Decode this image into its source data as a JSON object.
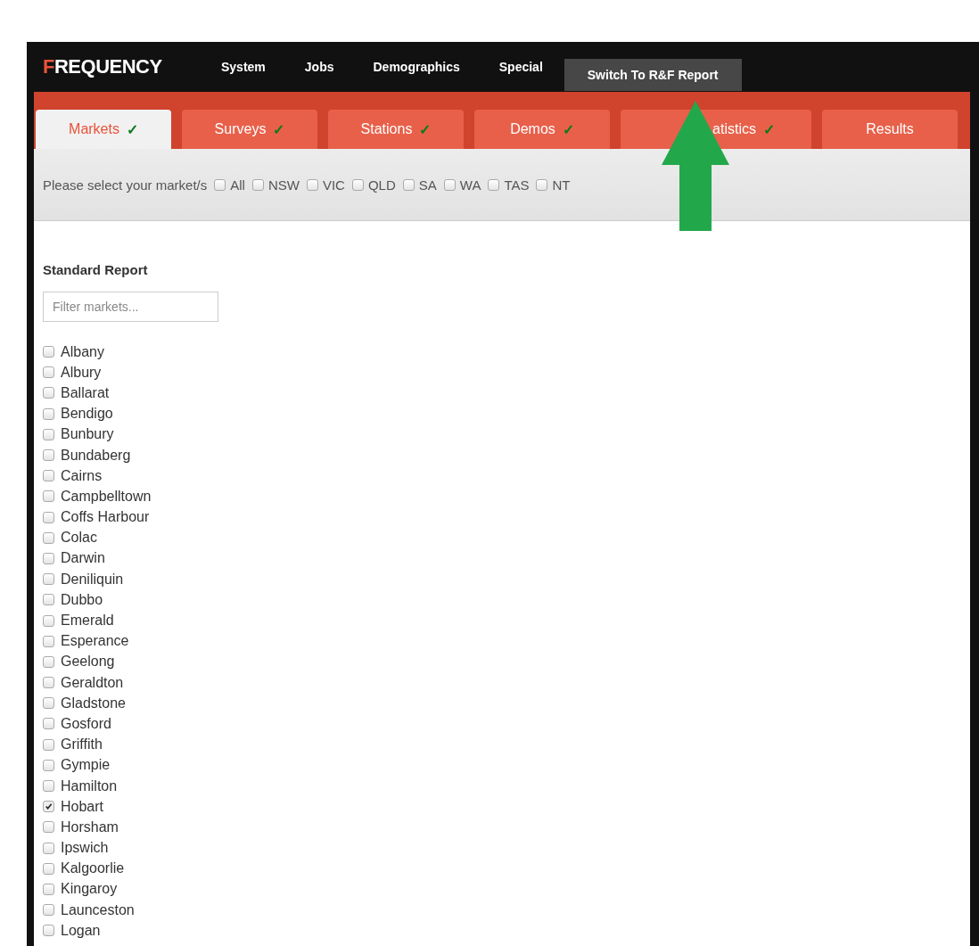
{
  "logo": {
    "initial": "F",
    "rest": "REQUENCY"
  },
  "nav": [
    {
      "label": "System",
      "selected": false
    },
    {
      "label": "Jobs",
      "selected": false
    },
    {
      "label": "Demographics",
      "selected": false
    },
    {
      "label": "Special",
      "selected": false
    },
    {
      "label": "Switch To R&F Report",
      "selected": true
    }
  ],
  "tabs": [
    {
      "label": "Markets",
      "check": "✓",
      "selected": true
    },
    {
      "label": "Surveys",
      "check": "✓",
      "selected": false
    },
    {
      "label": "Stations",
      "check": "✓",
      "selected": false
    },
    {
      "label": "Demos",
      "check": "✓",
      "selected": false
    },
    {
      "label": "atistics",
      "check": "✓",
      "selected": false,
      "covered": true
    },
    {
      "label": "Results",
      "selected": false
    }
  ],
  "region_bar": {
    "prompt": "Please select your market/s",
    "regions": [
      {
        "label": "All",
        "checked": false
      },
      {
        "label": "NSW",
        "checked": false
      },
      {
        "label": "VIC",
        "checked": false
      },
      {
        "label": "QLD",
        "checked": false
      },
      {
        "label": "SA",
        "checked": false
      },
      {
        "label": "WA",
        "checked": false
      },
      {
        "label": "TAS",
        "checked": false
      },
      {
        "label": "NT",
        "checked": false
      }
    ]
  },
  "section_title": "Standard Report",
  "filter": {
    "placeholder": "Filter markets..."
  },
  "markets": [
    {
      "label": "Albany",
      "checked": false
    },
    {
      "label": "Albury",
      "checked": false
    },
    {
      "label": "Ballarat",
      "checked": false
    },
    {
      "label": "Bendigo",
      "checked": false
    },
    {
      "label": "Bunbury",
      "checked": false
    },
    {
      "label": "Bundaberg",
      "checked": false
    },
    {
      "label": "Cairns",
      "checked": false
    },
    {
      "label": "Campbelltown",
      "checked": false
    },
    {
      "label": "Coffs Harbour",
      "checked": false
    },
    {
      "label": "Colac",
      "checked": false
    },
    {
      "label": "Darwin",
      "checked": false
    },
    {
      "label": "Deniliquin",
      "checked": false
    },
    {
      "label": "Dubbo",
      "checked": false
    },
    {
      "label": "Emerald",
      "checked": false
    },
    {
      "label": "Esperance",
      "checked": false
    },
    {
      "label": "Geelong",
      "checked": false
    },
    {
      "label": "Geraldton",
      "checked": false
    },
    {
      "label": "Gladstone",
      "checked": false
    },
    {
      "label": "Gosford",
      "checked": false
    },
    {
      "label": "Griffith",
      "checked": false
    },
    {
      "label": "Gympie",
      "checked": false
    },
    {
      "label": "Hamilton",
      "checked": false
    },
    {
      "label": "Hobart",
      "checked": true
    },
    {
      "label": "Horsham",
      "checked": false
    },
    {
      "label": "Ipswich",
      "checked": false
    },
    {
      "label": "Kalgoorlie",
      "checked": false
    },
    {
      "label": "Kingaroy",
      "checked": false
    },
    {
      "label": "Launceston",
      "checked": false
    },
    {
      "label": "Logan",
      "checked": false
    }
  ]
}
